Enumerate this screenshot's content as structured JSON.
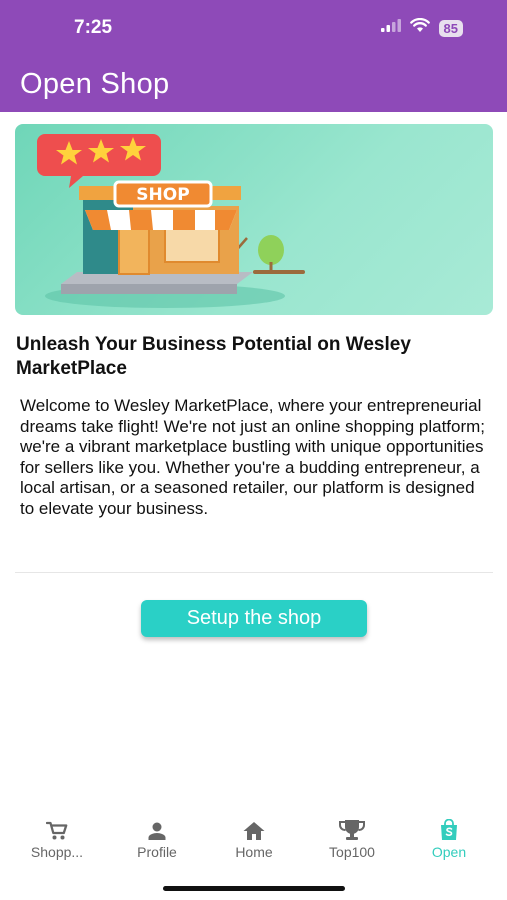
{
  "status_bar": {
    "time": "7:25",
    "battery": "85",
    "icons": [
      "signal-icon",
      "wifi-icon",
      "battery-icon"
    ]
  },
  "app_bar": {
    "title": "Open Shop"
  },
  "hero": {
    "sign_text": "SHOP",
    "rating_stars": 3
  },
  "content": {
    "headline": "Unleash Your Business Potential on Wesley MarketPlace",
    "body": "Welcome to Wesley MarketPlace, where your entrepreneurial dreams take flight! We're not just an online shopping platform; we're a vibrant marketplace bustling with unique opportunities for sellers like you. Whether you're a budding entrepreneur, a local artisan, or a seasoned retailer, our platform is designed to elevate your business."
  },
  "actions": {
    "setup_label": "Setup the shop"
  },
  "tabs": [
    {
      "label": "Shopp...",
      "icon": "cart-icon"
    },
    {
      "label": "Profile",
      "icon": "person-icon"
    },
    {
      "label": "Home",
      "icon": "home-icon"
    },
    {
      "label": "Top100",
      "icon": "trophy-icon"
    },
    {
      "label": "Open",
      "icon": "shopping-bag-icon",
      "active": true
    }
  ],
  "colors": {
    "primary": "#8e4ab8",
    "accent": "#2ad0c6",
    "active_tab": "#33cdbd"
  }
}
